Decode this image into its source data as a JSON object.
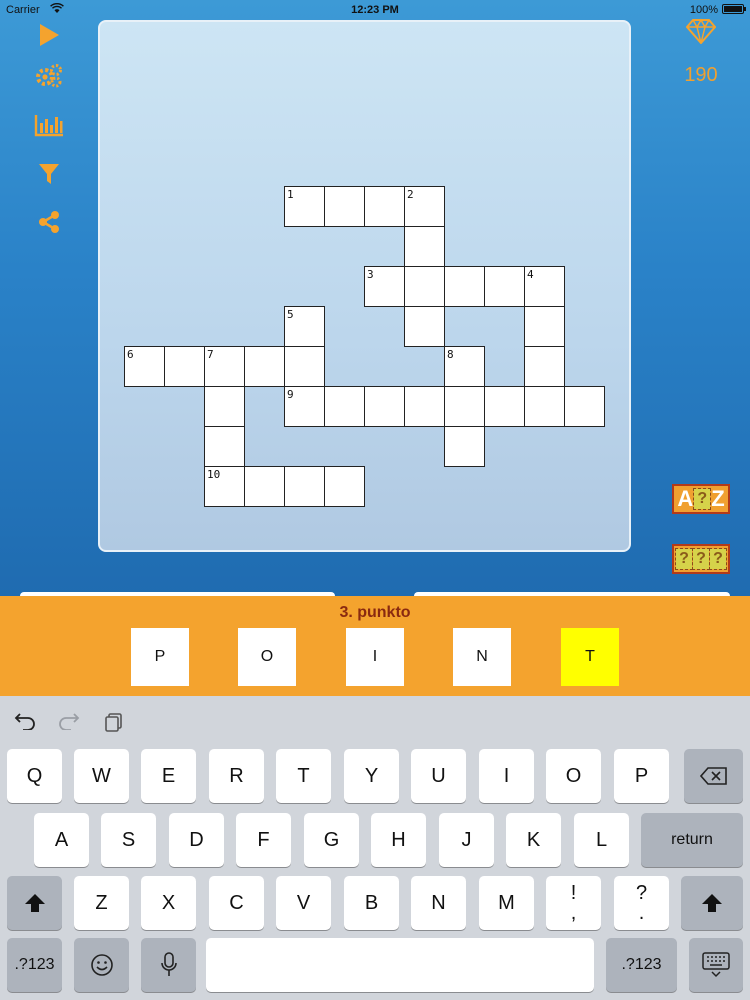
{
  "status": {
    "carrier": "Carrier",
    "time": "12:23 PM",
    "battery": "100%"
  },
  "toolbar": {
    "icons": [
      "play-icon",
      "settings-gears-icon",
      "stats-chart-icon",
      "filter-icon",
      "share-icon"
    ]
  },
  "gems": {
    "icon": "diamond-icon",
    "count": "190"
  },
  "hints": {
    "reveal_letter": {
      "left": "A",
      "mid": "?",
      "right": "Z"
    },
    "reveal_word": [
      "?",
      "?",
      "?"
    ]
  },
  "crossword": {
    "numbers": [
      "1",
      "2",
      "3",
      "4",
      "5",
      "6",
      "7",
      "8",
      "9",
      "10"
    ]
  },
  "clue": {
    "title": "3. punkto",
    "letters": [
      "P",
      "O",
      "I",
      "N",
      "T"
    ],
    "active_index": 4
  },
  "keyboard": {
    "row1": [
      "Q",
      "W",
      "E",
      "R",
      "T",
      "Y",
      "U",
      "I",
      "O",
      "P"
    ],
    "row2": [
      "A",
      "S",
      "D",
      "F",
      "G",
      "H",
      "J",
      "K",
      "L"
    ],
    "row3": [
      "Z",
      "X",
      "C",
      "V",
      "B",
      "N",
      "M"
    ],
    "punct1": {
      "top": "!",
      "bottom": ","
    },
    "punct2": {
      "top": "?",
      "bottom": "."
    },
    "return_label": "return",
    "numbers_label": ".?123",
    "icons": [
      "undo-icon",
      "redo-icon",
      "paste-icon",
      "backspace-icon",
      "shift-icon",
      "emoji-icon",
      "microphone-icon",
      "hide-keyboard-icon"
    ]
  },
  "colors": {
    "accent": "#f4a32e",
    "active_cell": "#ffff00",
    "clue_title": "#8a2a10"
  }
}
